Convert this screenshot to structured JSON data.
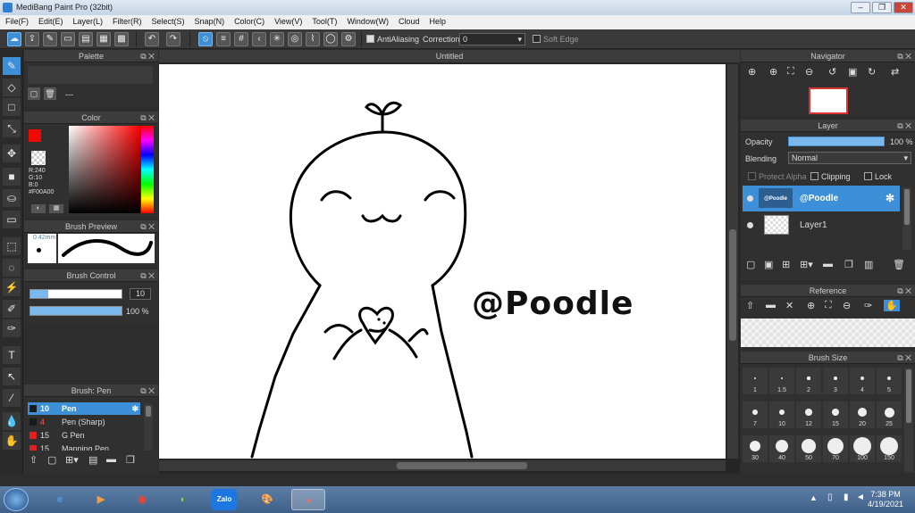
{
  "window": {
    "title": "MediBang Paint Pro (32bit)"
  },
  "menu": [
    "File(F)",
    "Edit(E)",
    "Layer(L)",
    "Filter(R)",
    "Select(S)",
    "Snap(N)",
    "Color(C)",
    "View(V)",
    "Tool(T)",
    "Window(W)",
    "Cloud",
    "Help"
  ],
  "toolbar": {
    "antialiasing_label": "AntiAliasing",
    "correction_label": "Correction",
    "correction_value": "0",
    "soft_edge_label": "Soft Edge"
  },
  "panels": {
    "palette": {
      "title": "Palette",
      "entry": "---"
    },
    "color": {
      "title": "Color",
      "r": "R:240",
      "g": "G:10",
      "b": "B:0",
      "hex": "#F00A00",
      "current": "#F00A00"
    },
    "brush_preview": {
      "title": "Brush Preview",
      "size": "0.42mm"
    },
    "brush_control": {
      "title": "Brush Control",
      "size": "10",
      "opacity": "100 %",
      "size_fraction": 0.2,
      "opacity_fraction": 1.0
    },
    "brush_list": {
      "title": "Brush: Pen",
      "items": [
        {
          "size": "10",
          "name": "Pen",
          "color": "#1a1a1a"
        },
        {
          "size": "4",
          "name": "Pen (Sharp)",
          "color": "#1a1a1a"
        },
        {
          "size": "15",
          "name": "G Pen",
          "color": "#e02020"
        },
        {
          "size": "15",
          "name": "Mapping Pen",
          "color": "#e02020"
        }
      ]
    }
  },
  "canvas": {
    "tab": "Untitled",
    "watermark": "@Poodle"
  },
  "right": {
    "navigator": {
      "title": "Navigator"
    },
    "layer": {
      "title": "Layer",
      "opacity_label": "Opacity",
      "opacity_value": "100 %",
      "blending_label": "Blending",
      "blending_value": "Normal",
      "protect_alpha": "Protect Alpha",
      "clipping": "Clipping",
      "lock": "Lock",
      "layers": [
        {
          "name": "@Poodle",
          "thumb": "@Poodle"
        },
        {
          "name": "Layer1",
          "thumb": ""
        }
      ]
    },
    "reference": {
      "title": "Reference"
    },
    "brush_size": {
      "title": "Brush Size",
      "sizes": [
        "1",
        "1.5",
        "2",
        "3",
        "4",
        "5",
        "7",
        "10",
        "12",
        "15",
        "20",
        "25",
        "30",
        "40",
        "50",
        "70",
        "100",
        "150"
      ]
    }
  },
  "taskbar": {
    "time": "7:38 PM",
    "date": "4/19/2021",
    "zalo": "Zalo"
  }
}
